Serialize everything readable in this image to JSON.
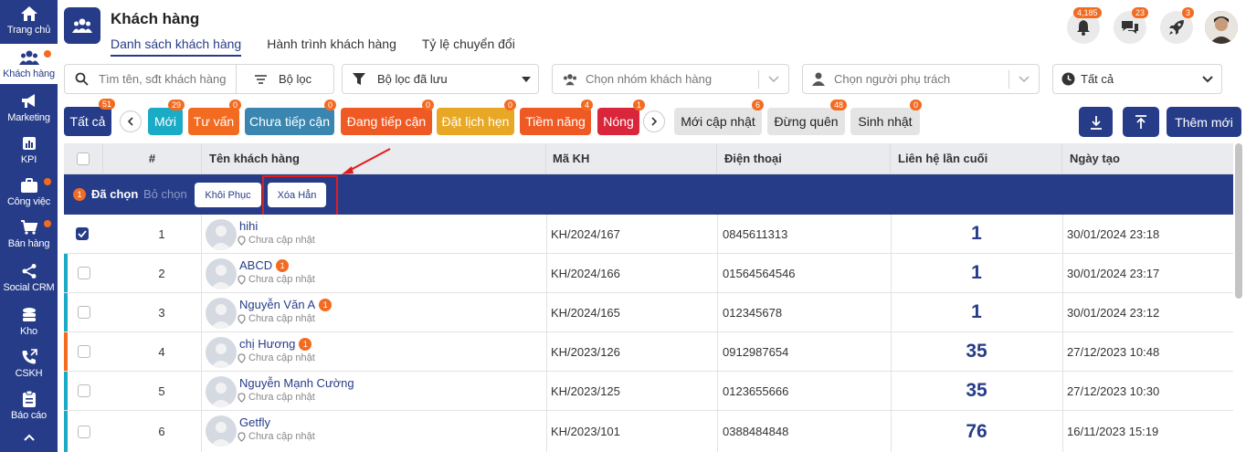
{
  "sidebar": {
    "items": [
      {
        "label": "Trang chủ",
        "icon": "home-icon"
      },
      {
        "label": "Khách hàng",
        "icon": "users-icon"
      },
      {
        "label": "Marketing",
        "icon": "megaphone-icon"
      },
      {
        "label": "KPI",
        "icon": "chart-icon"
      },
      {
        "label": "Công việc",
        "icon": "briefcase-icon"
      },
      {
        "label": "Bán hàng",
        "icon": "cart-icon"
      },
      {
        "label": "Social CRM",
        "icon": "share-icon"
      },
      {
        "label": "Kho",
        "icon": "database-icon"
      },
      {
        "label": "CSKH",
        "icon": "phone-icon"
      },
      {
        "label": "Báo cáo",
        "icon": "clipboard-icon"
      }
    ]
  },
  "header": {
    "title": "Khách hàng",
    "tabs": [
      "Danh sách khách hàng",
      "Hành trình khách hàng",
      "Tỷ lệ chuyển đổi"
    ],
    "notifications": "4,185",
    "messages": "23",
    "rocket": "3"
  },
  "filters": {
    "search_placeholder": "Tìm tên, sđt khách hàng",
    "filter_label": "Bộ lọc",
    "saved_filter": "Bộ lọc đã lưu",
    "group_placeholder": "Chọn nhóm khách hàng",
    "owner_placeholder": "Chọn người phụ trách",
    "time_value": "Tất cả"
  },
  "statuses": [
    {
      "label": "Tất cả",
      "count": "51"
    },
    {
      "label": "Mới",
      "count": "29"
    },
    {
      "label": "Tư vấn",
      "count": "0"
    },
    {
      "label": "Chưa tiếp cận",
      "count": "0"
    },
    {
      "label": "Đang tiếp cận",
      "count": "0"
    },
    {
      "label": "Đặt lịch hẹn",
      "count": "0"
    },
    {
      "label": "Tiềm năng",
      "count": "4"
    },
    {
      "label": "Nóng",
      "count": "1"
    },
    {
      "label": "Mới cập nhật",
      "count": "6"
    },
    {
      "label": "Đừng quên",
      "count": "48"
    },
    {
      "label": "Sinh nhật",
      "count": "0"
    }
  ],
  "actions": {
    "add_new": "Thêm mới"
  },
  "table": {
    "headers": [
      "#",
      "Tên khách hàng",
      "Mã KH",
      "Điện thoại",
      "Liên hệ lần cuối",
      "Ngày tạo"
    ],
    "selection": {
      "count": "1",
      "selected_label": "Đã chọn",
      "deselect_label": "Bỏ chọn",
      "restore_label": "Khôi Phục",
      "delete_label": "Xóa Hẳn"
    },
    "location_text": "Chưa cập nhật",
    "rows": [
      {
        "no": "1",
        "name": "hihi",
        "code": "KH/2024/167",
        "phone": "0845611313",
        "last": "1",
        "created": "30/01/2024 23:18"
      },
      {
        "no": "2",
        "name": "ABCD",
        "badge": "1",
        "code": "KH/2024/166",
        "phone": "01564564546",
        "last": "1",
        "created": "30/01/2024 23:17"
      },
      {
        "no": "3",
        "name": "Nguyễn Văn A",
        "badge": "1",
        "code": "KH/2024/165",
        "phone": "012345678",
        "last": "1",
        "created": "30/01/2024 23:12"
      },
      {
        "no": "4",
        "name": "chị Hương",
        "badge": "1",
        "code": "KH/2023/126",
        "phone": "0912987654",
        "last": "35",
        "created": "27/12/2023 10:48"
      },
      {
        "no": "5",
        "name": "Nguyễn Mạnh Cường",
        "code": "KH/2023/125",
        "phone": "0123655666",
        "last": "35",
        "created": "27/12/2023 10:30"
      },
      {
        "no": "6",
        "name": "Getfly",
        "code": "KH/2023/101",
        "phone": "0388484848",
        "last": "76",
        "created": "16/11/2023 15:19"
      }
    ]
  },
  "colors": {
    "brand": "#263c88",
    "moi": "#1aabc6",
    "tuvan": "#f26b21",
    "chuatiepcan": "#3a86b0",
    "dangtiepcan": "#ef5a24",
    "datlichhen": "#e8a825",
    "tiemnang": "#ef5a24",
    "nong": "#d9263b",
    "badge": "#f26b21",
    "highlight": "#e51b1b"
  }
}
